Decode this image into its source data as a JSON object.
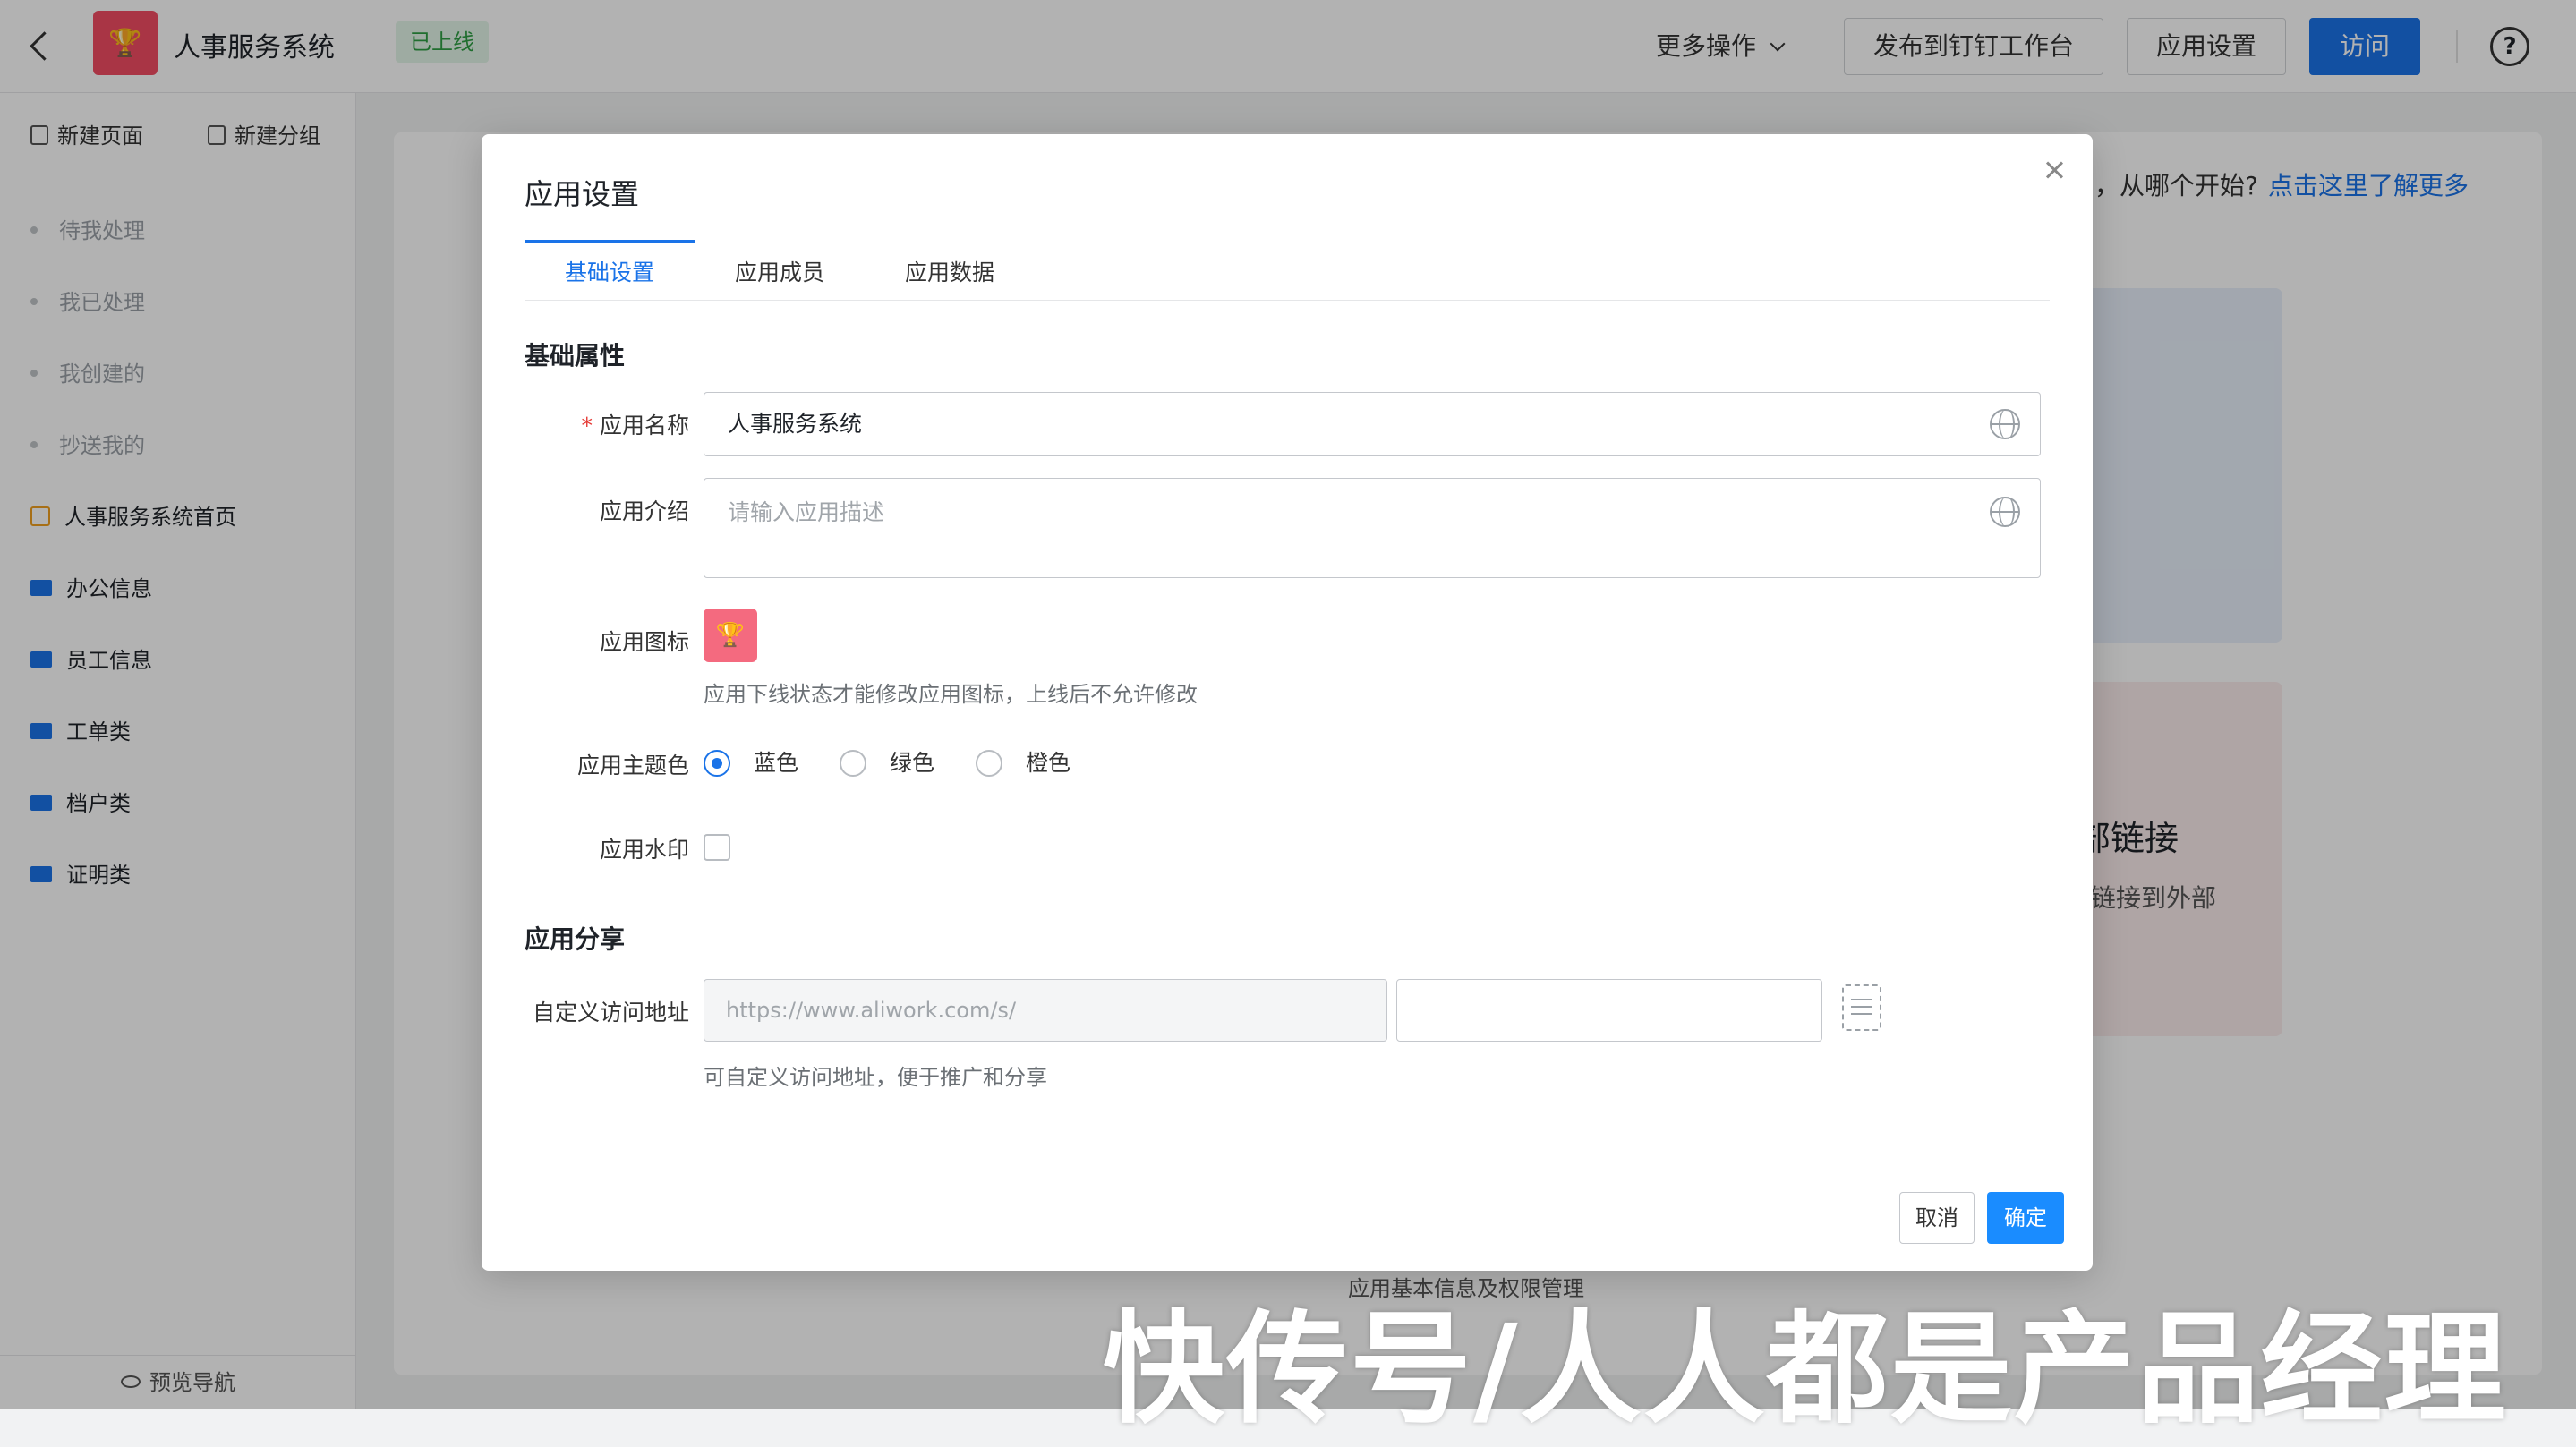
{
  "header": {
    "app_title": "人事服务系统",
    "status_badge": "已上线",
    "more_actions": "更多操作",
    "publish_button": "发布到钉钉工作台",
    "settings_button": "应用设置",
    "visit_button": "访问",
    "help_icon": "?"
  },
  "sidebar": {
    "new_page": "新建页面",
    "new_group": "新建分组",
    "items": [
      {
        "label": "待我处理"
      },
      {
        "label": "我已处理"
      },
      {
        "label": "我创建的"
      },
      {
        "label": "抄送我的"
      },
      {
        "label": "人事服务系统首页"
      },
      {
        "label": "办公信息"
      },
      {
        "label": "员工信息"
      },
      {
        "label": "工单类"
      },
      {
        "label": "档户类"
      },
      {
        "label": "证明类"
      }
    ],
    "preview_nav": "预览导航"
  },
  "background": {
    "hint_text": "，从哪个开始?",
    "hint_link": "点击这里了解更多",
    "tile_title": "部链接",
    "tile_desc": "链接到外部",
    "caption": "应用基本信息及权限管理"
  },
  "modal": {
    "title": "应用设置",
    "tabs": [
      {
        "label": "基础设置"
      },
      {
        "label": "应用成员"
      },
      {
        "label": "应用数据"
      }
    ],
    "section_basic": "基础属性",
    "name_label": "应用名称",
    "name_value": "人事服务系统",
    "intro_label": "应用介绍",
    "intro_placeholder": "请输入应用描述",
    "icon_label": "应用图标",
    "icon_help": "应用下线状态才能修改应用图标，上线后不允许修改",
    "theme_label": "应用主题色",
    "theme_options": [
      {
        "label": "蓝色"
      },
      {
        "label": "绿色"
      },
      {
        "label": "橙色"
      }
    ],
    "watermark_label": "应用水印",
    "section_share": "应用分享",
    "url_label": "自定义访问地址",
    "url_prefix": "https://www.aliwork.com/s/",
    "url_value": "",
    "url_help": "可自定义访问地址，便于推广和分享",
    "cancel": "取消",
    "ok": "确定"
  },
  "watermark_text": "快传号/人人都是产品经理",
  "colors": {
    "primary": "#1a73e8",
    "ok_button": "#1a8cff",
    "app_icon": "#f24d63",
    "status_green": "#2f9e44"
  }
}
